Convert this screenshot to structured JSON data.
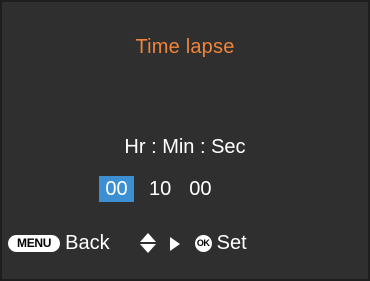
{
  "screen": {
    "title": "Time lapse",
    "title_color": "#f0843a",
    "background_color": "#2f2f2f"
  },
  "time": {
    "header": "Hr : Min : Sec",
    "hours": "00",
    "minutes": "10",
    "seconds": "00",
    "selected_field": "hours",
    "highlight_color": "#3d8fd4"
  },
  "footer": {
    "menu_key_label": "MENU",
    "back_label": "Back",
    "updown_icon": "up-down-triangle-icon",
    "right_icon": "right-triangle-icon",
    "ok_key_label": "OK",
    "set_label": "Set"
  }
}
